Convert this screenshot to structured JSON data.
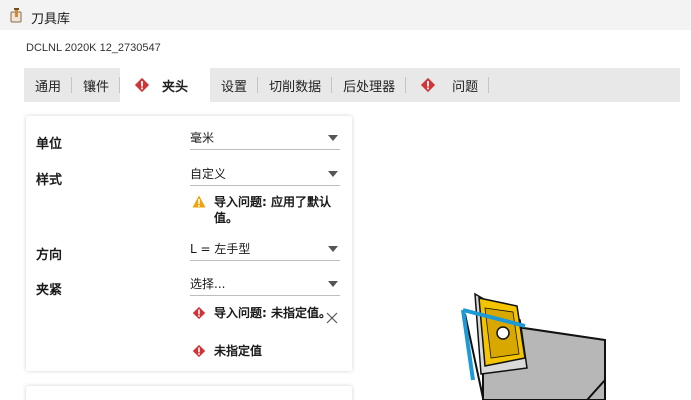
{
  "window": {
    "title": "刀具库"
  },
  "header": {
    "subtitle": "DCLNL 2020K 12_2730547"
  },
  "tabs": [
    {
      "label": "通用",
      "error": false,
      "active": false
    },
    {
      "label": "镶件",
      "error": false,
      "active": false
    },
    {
      "label": "夹头",
      "error": true,
      "active": true
    },
    {
      "label": "设置",
      "error": false,
      "active": false
    },
    {
      "label": "切削数据",
      "error": false,
      "active": false
    },
    {
      "label": "后处理器",
      "error": false,
      "active": false
    },
    {
      "label": "问题",
      "error": true,
      "active": false
    }
  ],
  "form": {
    "unit": {
      "label": "单位",
      "value": "毫米"
    },
    "style": {
      "label": "样式",
      "value": "自定义",
      "warning": "导入问题: 应用了默认值。"
    },
    "direction": {
      "label": "方向",
      "value": "L = 左手型"
    },
    "clamp": {
      "label": "夹紧",
      "value": "选择...",
      "error1": "导入问题: 未指定值。",
      "error2": "未指定值"
    }
  },
  "colors": {
    "error": "#d13438",
    "warning": "#f0a30a",
    "insert": "#f5c400",
    "holder": "#b7b7b7",
    "edge": "#1d9ad6"
  },
  "icons": {
    "app": "tool-library-icon",
    "error": "error-diamond-icon",
    "warning": "warning-triangle-icon",
    "dropdown": "chevron-down-icon",
    "close": "close-icon"
  }
}
